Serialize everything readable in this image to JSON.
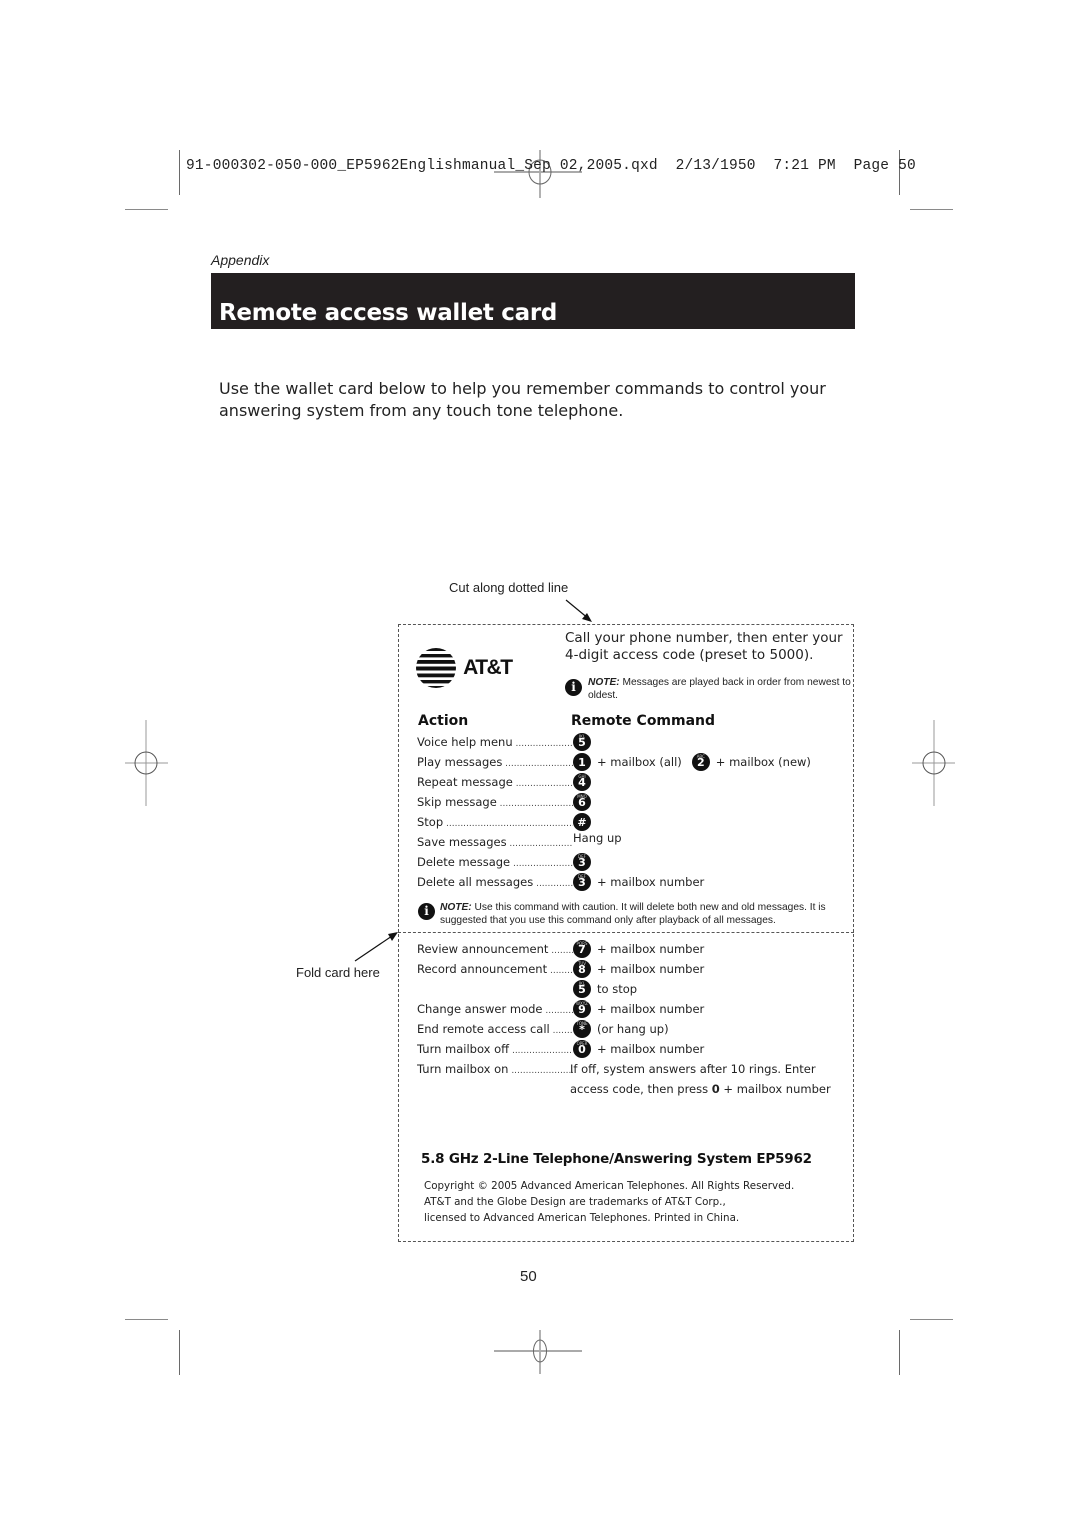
{
  "slug_line": "91-000302-050-000_EP5962Englishmanual_Sep 02,2005.qxd  2/13/1950  7:21 PM  Page 50",
  "section_label": "Appendix",
  "title": "Remote access wallet card",
  "intro": "Use the wallet card below to help you remember commands to control your answering system from any touch tone telephone.",
  "cut_label": "Cut along dotted line",
  "fold_label": "Fold card here",
  "card": {
    "logo_text": "AT&T",
    "call_instruction": "Call your phone number, then enter your 4-digit access code (preset to 5000).",
    "note1": {
      "label": "NOTE:",
      "text": " Messages are played back in order from newest to oldest."
    },
    "headers": {
      "action": "Action",
      "command": "Remote Command"
    },
    "commands": [
      {
        "action": "Voice help menu",
        "keys": [
          {
            "digit": "5",
            "letters": "JKL"
          }
        ],
        "suffix": ""
      },
      {
        "action": "Play messages",
        "keys": [
          {
            "digit": "1",
            "letters": ""
          }
        ],
        "suffix": "+ mailbox (all)",
        "keys2": [
          {
            "digit": "2",
            "letters": "ABC"
          }
        ],
        "suffix2": "+ mailbox (new)"
      },
      {
        "action": "Repeat message",
        "keys": [
          {
            "digit": "4",
            "letters": "GHI"
          }
        ],
        "suffix": ""
      },
      {
        "action": "Skip message",
        "keys": [
          {
            "digit": "6",
            "letters": "MNO"
          }
        ],
        "suffix": ""
      },
      {
        "action": "Stop",
        "keys": [
          {
            "digit": "#",
            "letters": ""
          }
        ],
        "suffix": ""
      },
      {
        "action": "Save messages",
        "keys": [],
        "suffix": "Hang up"
      },
      {
        "action": "Delete message",
        "keys": [
          {
            "digit": "3",
            "letters": "DEF"
          }
        ],
        "suffix": ""
      },
      {
        "action": "Delete all messages",
        "keys": [
          {
            "digit": "3",
            "letters": "DEF"
          }
        ],
        "suffix": "+ mailbox number"
      }
    ],
    "note2": {
      "label": "NOTE:",
      "text": " Use this command with caution. It will delete both new and old messages. It is suggested that you use this command only after playback of all messages."
    },
    "commands2": [
      {
        "action": "Review announcement",
        "keys": [
          {
            "digit": "7",
            "letters": "PQRS"
          }
        ],
        "suffix": "+ mailbox number"
      },
      {
        "action": "Record announcement",
        "keys": [
          {
            "digit": "8",
            "letters": "TUV"
          }
        ],
        "suffix": "+ mailbox number"
      },
      {
        "action": "",
        "keys": [
          {
            "digit": "5",
            "letters": "JKL"
          }
        ],
        "suffix": "to stop"
      },
      {
        "action": "Change answer mode",
        "keys": [
          {
            "digit": "9",
            "letters": "WXYZ"
          }
        ],
        "suffix": "+ mailbox number"
      },
      {
        "action": "End remote access call",
        "keys": [
          {
            "digit": "*",
            "letters": "TONE"
          }
        ],
        "suffix": "(or hang up)"
      },
      {
        "action": "Turn mailbox off",
        "keys": [
          {
            "digit": "0",
            "letters": "OPER"
          }
        ],
        "suffix": "+ mailbox number"
      },
      {
        "action": "Turn mailbox on",
        "keys": [],
        "suffix": "If off, system answers after 10 rings. Enter"
      }
    ],
    "mailbox_on_line2": {
      "pre": "access code, then press ",
      "bold": "0",
      "post": " + mailbox number"
    },
    "product": "5.8 GHz 2-Line Telephone/Answering System EP5962",
    "copyright": [
      "Copyright © 2005 Advanced American Telephones. All Rights Reserved.",
      "AT&T and the Globe Design are trademarks of AT&T Corp.,",
      "licensed to Advanced American Telephones. Printed in China."
    ]
  },
  "page_number": "50"
}
